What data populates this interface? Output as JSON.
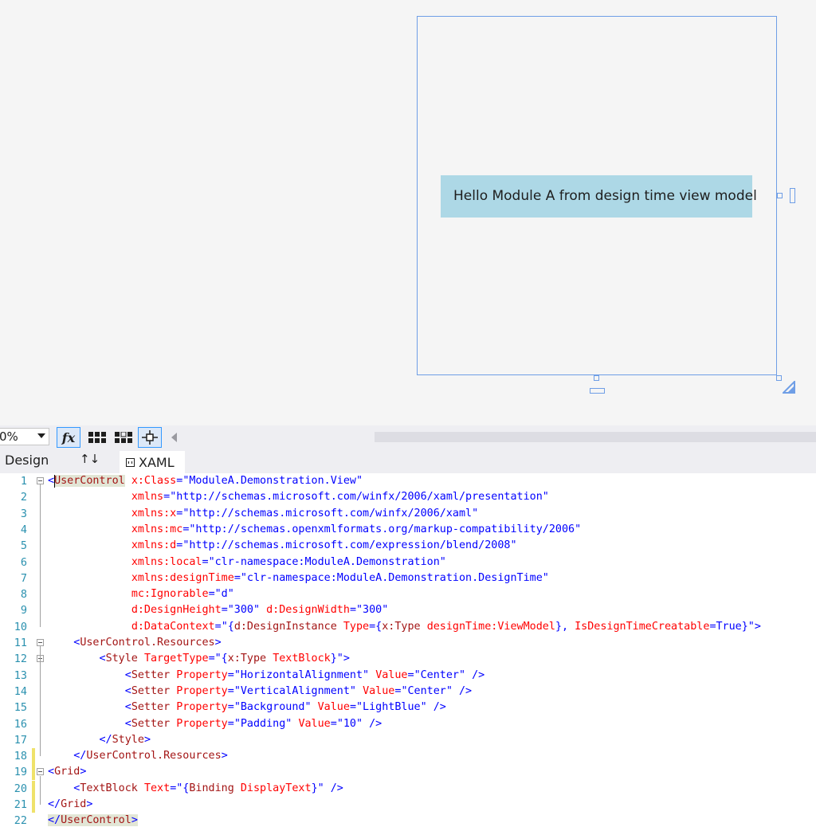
{
  "designer": {
    "preview_text": "Hello Module A from design time view model"
  },
  "toolbar": {
    "zoom_value": "0%",
    "fx_label": "fx"
  },
  "tabs": {
    "design_label": "Design",
    "swap_label": "↑↓",
    "xaml_label": "XAML"
  },
  "colors": {
    "tag": "#a31515",
    "attribute": "#ff0000",
    "value": "#0000ff",
    "line_number": "#2b91af",
    "selection_border": "#6f9ee6",
    "preview_background": "#add8e6",
    "change_marker": "#efe26a"
  },
  "editor": {
    "lines": [
      {
        "num": "1",
        "tokens": [
          [
            "p",
            "<"
          ],
          [
            "t",
            "UserControl"
          ],
          [
            "x",
            " "
          ],
          [
            "a",
            "x:Class"
          ],
          [
            "p",
            "="
          ],
          [
            "v",
            "\"ModuleA.Demonstration.View\""
          ]
        ]
      },
      {
        "num": "2",
        "tokens": [
          [
            "x",
            "             "
          ],
          [
            "a",
            "xmlns"
          ],
          [
            "p",
            "="
          ],
          [
            "v",
            "\"http://schemas.microsoft.com/winfx/2006/xaml/presentation\""
          ]
        ]
      },
      {
        "num": "3",
        "tokens": [
          [
            "x",
            "             "
          ],
          [
            "a",
            "xmlns:x"
          ],
          [
            "p",
            "="
          ],
          [
            "v",
            "\"http://schemas.microsoft.com/winfx/2006/xaml\""
          ]
        ]
      },
      {
        "num": "4",
        "tokens": [
          [
            "x",
            "             "
          ],
          [
            "a",
            "xmlns:mc"
          ],
          [
            "p",
            "="
          ],
          [
            "v",
            "\"http://schemas.openxmlformats.org/markup-compatibility/2006\""
          ]
        ]
      },
      {
        "num": "5",
        "tokens": [
          [
            "x",
            "             "
          ],
          [
            "a",
            "xmlns:d"
          ],
          [
            "p",
            "="
          ],
          [
            "v",
            "\"http://schemas.microsoft.com/expression/blend/2008\""
          ]
        ]
      },
      {
        "num": "6",
        "tokens": [
          [
            "x",
            "             "
          ],
          [
            "a",
            "xmlns:local"
          ],
          [
            "p",
            "="
          ],
          [
            "v",
            "\"clr-namespace:ModuleA.Demonstration\""
          ]
        ]
      },
      {
        "num": "7",
        "tokens": [
          [
            "x",
            "             "
          ],
          [
            "a",
            "xmlns:designTime"
          ],
          [
            "p",
            "="
          ],
          [
            "v",
            "\"clr-namespace:ModuleA.Demonstration.DesignTime\""
          ]
        ]
      },
      {
        "num": "8",
        "tokens": [
          [
            "x",
            "             "
          ],
          [
            "a",
            "mc:Ignorable"
          ],
          [
            "p",
            "="
          ],
          [
            "v",
            "\"d\""
          ]
        ]
      },
      {
        "num": "9",
        "tokens": [
          [
            "x",
            "             "
          ],
          [
            "a",
            "d:DesignHeight"
          ],
          [
            "p",
            "="
          ],
          [
            "v",
            "\"300\""
          ],
          [
            "x",
            " "
          ],
          [
            "a",
            "d:DesignWidth"
          ],
          [
            "p",
            "="
          ],
          [
            "v",
            "\"300\""
          ]
        ]
      },
      {
        "num": "10",
        "tokens": [
          [
            "x",
            "             "
          ],
          [
            "a",
            "d:DataContext"
          ],
          [
            "p",
            "="
          ],
          [
            "v",
            "\"{"
          ],
          [
            "t",
            "d:DesignInstance"
          ],
          [
            "x",
            " "
          ],
          [
            "a",
            "Type"
          ],
          [
            "v",
            "={"
          ],
          [
            "t",
            "x:Type"
          ],
          [
            "x",
            " "
          ],
          [
            "a",
            "designTime:ViewModel"
          ],
          [
            "v",
            "}, "
          ],
          [
            "a",
            "IsDesignTimeCreatable"
          ],
          [
            "v",
            "=True}\""
          ],
          [
            "p",
            ">"
          ]
        ]
      },
      {
        "num": "11",
        "tokens": [
          [
            "x",
            "    "
          ],
          [
            "p",
            "<"
          ],
          [
            "t",
            "UserControl.Resources"
          ],
          [
            "p",
            ">"
          ]
        ]
      },
      {
        "num": "12",
        "tokens": [
          [
            "x",
            "        "
          ],
          [
            "p",
            "<"
          ],
          [
            "t",
            "Style"
          ],
          [
            "x",
            " "
          ],
          [
            "a",
            "TargetType"
          ],
          [
            "p",
            "="
          ],
          [
            "v",
            "\"{"
          ],
          [
            "t",
            "x:Type"
          ],
          [
            "x",
            " "
          ],
          [
            "a",
            "TextBlock"
          ],
          [
            "v",
            "}\""
          ],
          [
            "p",
            ">"
          ]
        ]
      },
      {
        "num": "13",
        "tokens": [
          [
            "x",
            "            "
          ],
          [
            "p",
            "<"
          ],
          [
            "t",
            "Setter"
          ],
          [
            "x",
            " "
          ],
          [
            "a",
            "Property"
          ],
          [
            "p",
            "="
          ],
          [
            "v",
            "\"HorizontalAlignment\""
          ],
          [
            "x",
            " "
          ],
          [
            "a",
            "Value"
          ],
          [
            "p",
            "="
          ],
          [
            "v",
            "\"Center\""
          ],
          [
            "x",
            " "
          ],
          [
            "p",
            "/>"
          ]
        ]
      },
      {
        "num": "14",
        "tokens": [
          [
            "x",
            "            "
          ],
          [
            "p",
            "<"
          ],
          [
            "t",
            "Setter"
          ],
          [
            "x",
            " "
          ],
          [
            "a",
            "Property"
          ],
          [
            "p",
            "="
          ],
          [
            "v",
            "\"VerticalAlignment\""
          ],
          [
            "x",
            " "
          ],
          [
            "a",
            "Value"
          ],
          [
            "p",
            "="
          ],
          [
            "v",
            "\"Center\""
          ],
          [
            "x",
            " "
          ],
          [
            "p",
            "/>"
          ]
        ]
      },
      {
        "num": "15",
        "tokens": [
          [
            "x",
            "            "
          ],
          [
            "p",
            "<"
          ],
          [
            "t",
            "Setter"
          ],
          [
            "x",
            " "
          ],
          [
            "a",
            "Property"
          ],
          [
            "p",
            "="
          ],
          [
            "v",
            "\"Background\""
          ],
          [
            "x",
            " "
          ],
          [
            "a",
            "Value"
          ],
          [
            "p",
            "="
          ],
          [
            "v",
            "\"LightBlue\""
          ],
          [
            "x",
            " "
          ],
          [
            "p",
            "/>"
          ]
        ]
      },
      {
        "num": "16",
        "tokens": [
          [
            "x",
            "            "
          ],
          [
            "p",
            "<"
          ],
          [
            "t",
            "Setter"
          ],
          [
            "x",
            " "
          ],
          [
            "a",
            "Property"
          ],
          [
            "p",
            "="
          ],
          [
            "v",
            "\"Padding\""
          ],
          [
            "x",
            " "
          ],
          [
            "a",
            "Value"
          ],
          [
            "p",
            "="
          ],
          [
            "v",
            "\"10\""
          ],
          [
            "x",
            " "
          ],
          [
            "p",
            "/>"
          ]
        ]
      },
      {
        "num": "17",
        "tokens": [
          [
            "x",
            "        "
          ],
          [
            "p",
            "</"
          ],
          [
            "t",
            "Style"
          ],
          [
            "p",
            ">"
          ]
        ]
      },
      {
        "num": "18",
        "tokens": [
          [
            "x",
            "    "
          ],
          [
            "p",
            "</"
          ],
          [
            "t",
            "UserControl.Resources"
          ],
          [
            "p",
            ">"
          ]
        ]
      },
      {
        "num": "19",
        "tokens": [
          [
            "p",
            "<"
          ],
          [
            "t",
            "Grid"
          ],
          [
            "p",
            ">"
          ]
        ]
      },
      {
        "num": "20",
        "tokens": [
          [
            "x",
            "    "
          ],
          [
            "p",
            "<"
          ],
          [
            "t",
            "TextBlock"
          ],
          [
            "x",
            " "
          ],
          [
            "a",
            "Text"
          ],
          [
            "p",
            "="
          ],
          [
            "v",
            "\"{"
          ],
          [
            "t",
            "Binding"
          ],
          [
            "x",
            " "
          ],
          [
            "a",
            "DisplayText"
          ],
          [
            "v",
            "}\""
          ],
          [
            "x",
            " "
          ],
          [
            "p",
            "/>"
          ]
        ]
      },
      {
        "num": "21",
        "tokens": [
          [
            "p",
            "</"
          ],
          [
            "t",
            "Grid"
          ],
          [
            "p",
            ">"
          ]
        ]
      },
      {
        "num": "22",
        "tokens": [
          [
            "p",
            "</"
          ],
          [
            "t",
            "UserControl"
          ],
          [
            "p",
            ">"
          ]
        ]
      }
    ]
  }
}
